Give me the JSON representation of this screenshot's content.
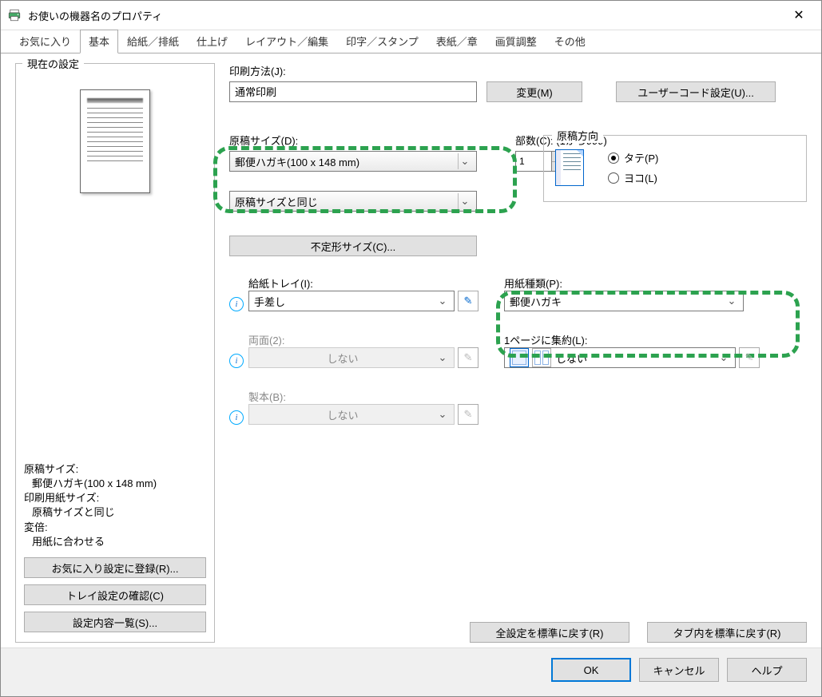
{
  "window": {
    "title": "お使いの機器名のプロパティ"
  },
  "tabs": {
    "items": [
      {
        "label": "お気に入り"
      },
      {
        "label": "基本"
      },
      {
        "label": "給紙／排紙"
      },
      {
        "label": "仕上げ"
      },
      {
        "label": "レイアウト／編集"
      },
      {
        "label": "印字／スタンプ"
      },
      {
        "label": "表紙／章"
      },
      {
        "label": "画質調整"
      },
      {
        "label": "その他"
      }
    ],
    "active_index": 1
  },
  "side": {
    "legend": "現在の設定",
    "info": {
      "doc_size_label": "原稿サイズ:",
      "doc_size_value": "郵便ハガキ(100 x 148 mm)",
      "print_size_label": "印刷用紙サイズ:",
      "print_size_value": "原稿サイズと同じ",
      "zoom_label": "変倍:",
      "zoom_value": "用紙に合わせる"
    },
    "buttons": {
      "register": "お気に入り設定に登録(R)...",
      "confirm_tray": "トレイ設定の確認(C)",
      "list_settings": "設定内容一覧(S)..."
    }
  },
  "main": {
    "print_method": {
      "label": "印刷方法(J):",
      "value": "通常印刷",
      "change_btn": "変更(M)",
      "usercode_btn": "ユーザーコード設定(U)..."
    },
    "doc_size": {
      "label": "原稿サイズ(D):",
      "value": "郵便ハガキ(100 x 148 mm)"
    },
    "copies": {
      "label": "部数(C): (1から999)",
      "value": "1"
    },
    "print_on": {
      "value": "原稿サイズと同じ"
    },
    "custom_size_btn": "不定形サイズ(C)...",
    "orientation": {
      "legend": "原稿方向",
      "portrait": "タテ(P)",
      "landscape": "ヨコ(L)",
      "selected": "portrait"
    },
    "tray": {
      "label": "給紙トレイ(I):",
      "value": "手差し"
    },
    "paper_type": {
      "label": "用紙種類(P):",
      "value": "郵便ハガキ"
    },
    "duplex": {
      "label": "両面(2):",
      "value": "しない"
    },
    "nup": {
      "label": "1ページに集約(L):",
      "value": "しない"
    },
    "booklet": {
      "label": "製本(B):",
      "value": "しない"
    },
    "reset_all_btn": "全設定を標準に戻す(R)",
    "reset_tab_btn": "タブ内を標準に戻す(R)"
  },
  "footer": {
    "ok": "OK",
    "cancel": "キャンセル",
    "help": "ヘルプ"
  }
}
